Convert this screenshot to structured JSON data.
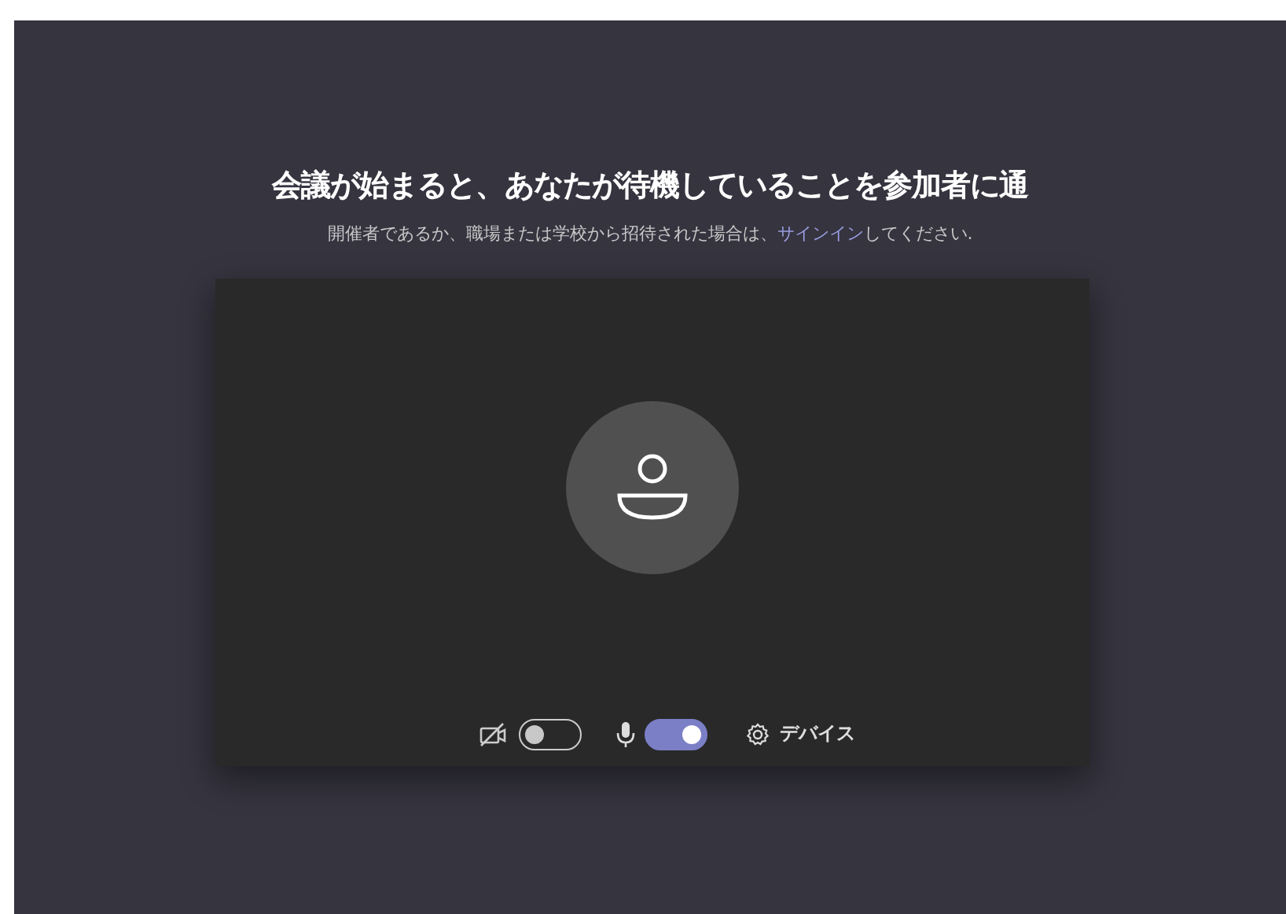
{
  "heading": "会議が始まると、あなたが待機していることを参加者に通",
  "notice": {
    "text_before": "開催者であるか、職場または学校から招待された場合は、",
    "link": "サインイン",
    "text_after": "してください."
  },
  "controls": [
    {
      "kind": "camera",
      "on": false
    },
    {
      "kind": "mic",
      "on": true
    },
    {
      "kind": "devices",
      "label": "デバイス"
    }
  ]
}
